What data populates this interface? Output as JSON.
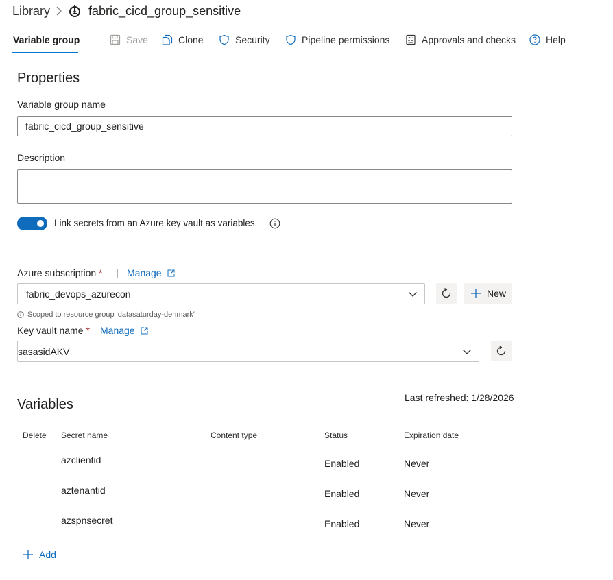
{
  "breadcrumb": {
    "library": "Library",
    "title": "fabric_cicd_group_sensitive"
  },
  "toolbar": {
    "tab_label": "Variable group",
    "save_label": "Save",
    "clone_label": "Clone",
    "security_label": "Security",
    "pipeline_permissions_label": "Pipeline permissions",
    "approvals_label": "Approvals and checks",
    "help_label": "Help"
  },
  "properties": {
    "heading": "Properties",
    "name_label": "Variable group name",
    "name_value": "fabric_cicd_group_sensitive",
    "description_label": "Description",
    "description_value": "",
    "link_secrets_label": "Link secrets from an Azure key vault as variables",
    "link_secrets_enabled": true
  },
  "keyvault": {
    "subscription_label": "Azure subscription",
    "required_mark": "*",
    "separator": "|",
    "manage_label": "Manage",
    "subscription_value": "fabric_devops_azurecon",
    "new_label": "New",
    "scope_note": "Scoped to resource group 'datasaturday-denmark'",
    "vault_label": "Key vault name",
    "vault_value": "sasasidAKV"
  },
  "variables": {
    "heading": "Variables",
    "last_refreshed": "Last refreshed: 1/28/2026",
    "columns": {
      "delete": "Delete",
      "secret_name": "Secret name",
      "content_type": "Content type",
      "status": "Status",
      "expiration": "Expiration date"
    },
    "rows": [
      {
        "name": "azclientid",
        "content_type": "",
        "status": "Enabled",
        "expiration": "Never"
      },
      {
        "name": "aztenantid",
        "content_type": "",
        "status": "Enabled",
        "expiration": "Never"
      },
      {
        "name": "azspnsecret",
        "content_type": "",
        "status": "Enabled",
        "expiration": "Never"
      }
    ],
    "add_label": "Add"
  },
  "colors": {
    "accent": "#0f6cbd",
    "tab_underline": "#0078d4",
    "required": "#a4262c",
    "disabled_text": "#a19f9d"
  }
}
